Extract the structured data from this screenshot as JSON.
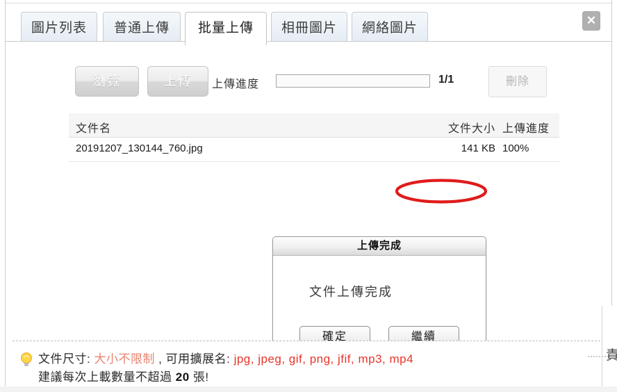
{
  "window": {
    "close_label": "✕"
  },
  "tabs": [
    {
      "label": "圖片列表",
      "active": false
    },
    {
      "label": "普通上傳",
      "active": false
    },
    {
      "label": "批量上傳",
      "active": true
    },
    {
      "label": "相冊圖片",
      "active": false
    },
    {
      "label": "網絡圖片",
      "active": false
    }
  ],
  "toolbar": {
    "browse_label": "瀏覽",
    "upload_label": "上傳",
    "progress_label": "上傳進度",
    "progress_percent": 0,
    "progress_count": "1/1",
    "delete_label": "刪除"
  },
  "table": {
    "headers": {
      "name": "文件名",
      "size": "文件大小",
      "progress": "上傳進度"
    },
    "rows": [
      {
        "name": "20191207_130144_760.jpg",
        "size": "141 KB",
        "progress": "100%"
      }
    ]
  },
  "annotation": {
    "shape": "ellipse",
    "color": "#e01b1b",
    "target": "141 KB"
  },
  "dialog": {
    "title": "上傳完成",
    "message": "文件上傳完成",
    "ok_label": "確定",
    "continue_label": "繼續"
  },
  "footer": {
    "line1_prefix": "文件尺寸: ",
    "line1_size_value": "大小不限制",
    "line1_middle": " , 可用擴展名: ",
    "line1_extensions": "jpg, jpeg, gif, png, jfif, mp3, mp4",
    "line2_prefix": "建議每次上載數量不超過 ",
    "line2_number": "20",
    "line2_suffix": " 張!",
    "bulb_icon": "lightbulb-icon"
  },
  "background": {
    "clipped_text": "責"
  },
  "colors": {
    "accent_red": "#e01b1b",
    "soft_red": "#e8836f",
    "strong_red": "#e8352a",
    "tab_active_bg": "#ffffff",
    "tab_inactive_bg": "#e3ebf3"
  }
}
